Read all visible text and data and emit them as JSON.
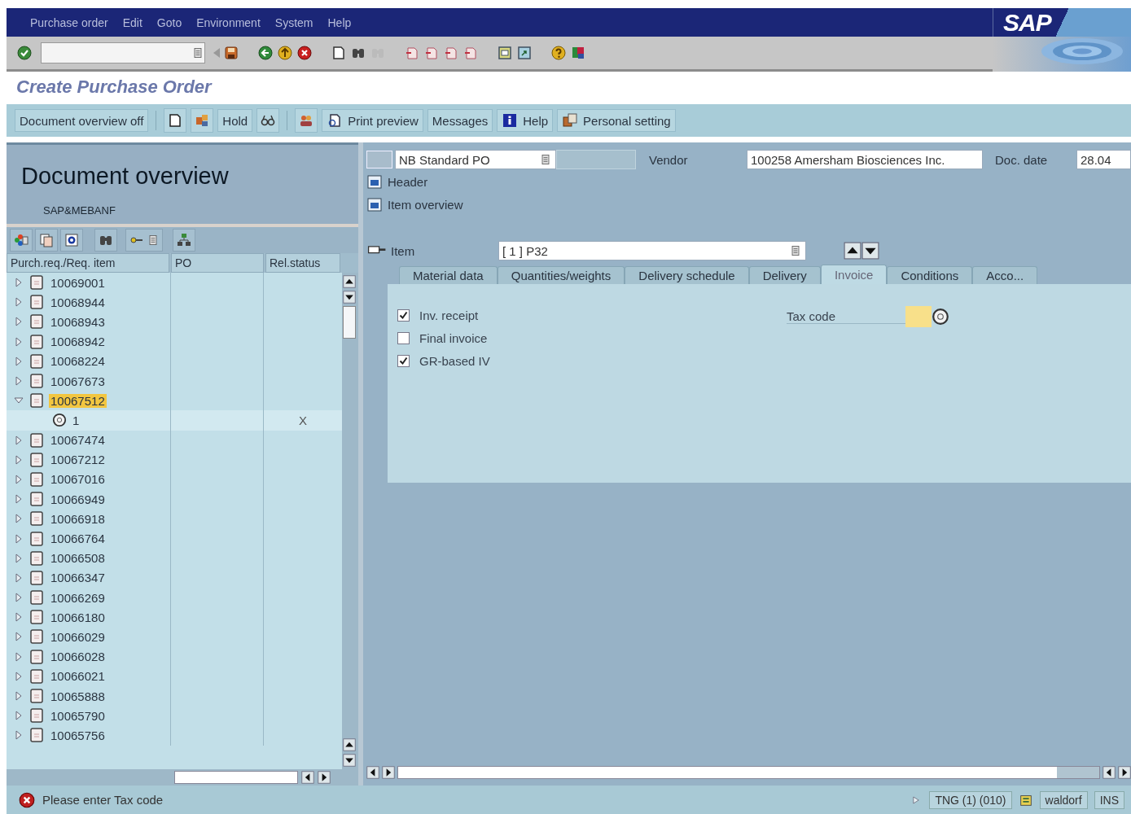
{
  "menu": [
    "Purchase order",
    "Edit",
    "Goto",
    "Environment",
    "System",
    "Help"
  ],
  "logo": "SAP",
  "title": "Create Purchase Order",
  "app_toolbar": [
    {
      "kind": "text",
      "label": "Document overview off"
    },
    {
      "kind": "separator"
    },
    {
      "kind": "icon"
    },
    {
      "kind": "icon"
    },
    {
      "kind": "text",
      "label": "Hold"
    },
    {
      "kind": "icon"
    },
    {
      "kind": "separator"
    },
    {
      "kind": "icon"
    },
    {
      "kind": "icon_text",
      "label": "Print preview"
    },
    {
      "kind": "text",
      "label": "Messages"
    },
    {
      "kind": "icon_text",
      "label": "Help"
    },
    {
      "kind": "icon_text",
      "label": "Personal setting"
    }
  ],
  "document_overview": {
    "title": "Document overview",
    "subtitle": "SAP&MEBANF",
    "columns": [
      "Purch.req./Req. item",
      "PO",
      "Rel.status"
    ],
    "rows": [
      {
        "label": "10069001",
        "expanded": false,
        "selected": false
      },
      {
        "label": "10068944",
        "expanded": false,
        "selected": false
      },
      {
        "label": "10068943",
        "expanded": false,
        "selected": false
      },
      {
        "label": "10068942",
        "expanded": false,
        "selected": false
      },
      {
        "label": "10068224",
        "expanded": false,
        "selected": false
      },
      {
        "label": "10067673",
        "expanded": false,
        "selected": false
      },
      {
        "label": "10067512",
        "expanded": true,
        "selected": true,
        "children": [
          {
            "label": "1",
            "rel_status": "X",
            "selected": false
          }
        ]
      },
      {
        "label": "10067474",
        "expanded": false,
        "selected": false
      },
      {
        "label": "10067212",
        "expanded": false,
        "selected": false
      },
      {
        "label": "10067016",
        "expanded": false,
        "selected": false
      },
      {
        "label": "10066949",
        "expanded": false,
        "selected": false
      },
      {
        "label": "10066918",
        "expanded": false,
        "selected": false
      },
      {
        "label": "10066764",
        "expanded": false,
        "selected": false
      },
      {
        "label": "10066508",
        "expanded": false,
        "selected": false
      },
      {
        "label": "10066347",
        "expanded": false,
        "selected": false
      },
      {
        "label": "10066269",
        "expanded": false,
        "selected": false
      },
      {
        "label": "10066180",
        "expanded": false,
        "selected": false
      },
      {
        "label": "10066029",
        "expanded": false,
        "selected": false
      },
      {
        "label": "10066028",
        "expanded": false,
        "selected": false
      },
      {
        "label": "10066021",
        "expanded": false,
        "selected": false
      },
      {
        "label": "10065888",
        "expanded": false,
        "selected": false
      },
      {
        "label": "10065790",
        "expanded": false,
        "selected": false
      },
      {
        "label": "10065756",
        "expanded": false,
        "selected": false
      }
    ]
  },
  "header_fields": {
    "document_type": "NB Standard PO",
    "vendor_label": "Vendor",
    "vendor": "100258 Amersham Biosciences Inc.",
    "doc_date_label": "Doc. date",
    "doc_date": "28.04"
  },
  "sections": [
    "Header",
    "Item overview"
  ],
  "item": {
    "label": "Item",
    "value": "[ 1 ] P32"
  },
  "tabs": [
    {
      "label": "Material data",
      "selected": false
    },
    {
      "label": "Quantities/weights",
      "selected": false
    },
    {
      "label": "Delivery schedule",
      "selected": false
    },
    {
      "label": "Delivery",
      "selected": false
    },
    {
      "label": "Invoice",
      "selected": true
    },
    {
      "label": "Conditions",
      "selected": false
    },
    {
      "label": "Acco...",
      "selected": false
    }
  ],
  "invoice": {
    "checkboxes": [
      {
        "label": "Inv. receipt",
        "checked": true
      },
      {
        "label": "Final invoice",
        "checked": false
      },
      {
        "label": "GR-based IV",
        "checked": true
      }
    ],
    "tax_code_label": "Tax code"
  },
  "status_bar": {
    "message": "Please enter Tax code",
    "system": "TNG (1) (010)",
    "server": "waldorf",
    "mode": "INS"
  }
}
